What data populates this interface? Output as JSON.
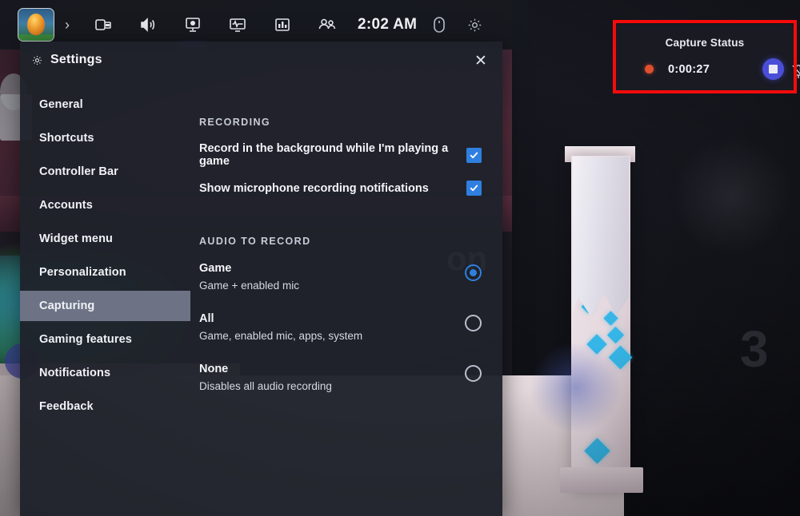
{
  "toolbar": {
    "game_thumbnail_name": "game-thumbnail",
    "expand_label": "›",
    "items": [
      {
        "id": "widget-store",
        "label": "Widget store",
        "icon": "widget-store-icon",
        "active": false
      },
      {
        "id": "audio",
        "label": "Audio",
        "icon": "speaker-icon",
        "active": false
      },
      {
        "id": "capture",
        "label": "Capture",
        "icon": "capture-monitor-icon",
        "active": true
      },
      {
        "id": "performance",
        "label": "Performance",
        "icon": "performance-monitor-icon",
        "active": false
      },
      {
        "id": "resources",
        "label": "Resources",
        "icon": "bar-chart-icon",
        "active": false
      },
      {
        "id": "xbox-social",
        "label": "Xbox Social",
        "icon": "people-icon",
        "active": false
      }
    ],
    "clock": "2:02 AM",
    "mouse_icon": "mouse-icon",
    "settings_icon": "gear-icon"
  },
  "settings": {
    "title": "Settings",
    "gear_icon": "gear-icon",
    "close_label": "✕",
    "nav": [
      {
        "label": "General",
        "selected": false
      },
      {
        "label": "Shortcuts",
        "selected": false
      },
      {
        "label": "Controller Bar",
        "selected": false
      },
      {
        "label": "Accounts",
        "selected": false
      },
      {
        "label": "Widget menu",
        "selected": false
      },
      {
        "label": "Personalization",
        "selected": false
      },
      {
        "label": "Capturing",
        "selected": true
      },
      {
        "label": "Gaming features",
        "selected": false
      },
      {
        "label": "Notifications",
        "selected": false
      },
      {
        "label": "Feedback",
        "selected": false
      }
    ],
    "recording": {
      "section_label": "RECORDING",
      "checkboxes": [
        {
          "label": "Record in the background while I'm playing a game",
          "checked": true
        },
        {
          "label": "Show microphone recording notifications",
          "checked": true
        }
      ]
    },
    "audio_to_record": {
      "section_label": "AUDIO TO RECORD",
      "options": [
        {
          "title": "Game",
          "subtitle": "Game + enabled mic",
          "selected": true
        },
        {
          "title": "All",
          "subtitle": "Game, enabled mic, apps, system",
          "selected": false
        },
        {
          "title": "None",
          "subtitle": "Disables all audio recording",
          "selected": false
        }
      ]
    }
  },
  "capture_status": {
    "title": "Capture Status",
    "recording_indicator": "recording-dot",
    "elapsed_time": "0:00:27",
    "stop_button_label": "stop-recording-button",
    "mic_icon": "microphone-muted-icon"
  },
  "annotation": {
    "name": "red-highlight-box",
    "color": "#f60b0b"
  },
  "colors": {
    "accent_blue": "#2f7fe0",
    "tab_indicator": "#3a5bd9",
    "record_red": "#e0502f",
    "stop_violet": "#4a4ed6",
    "panel_bg": "#1f222a",
    "nav_selected": "#6d7385"
  },
  "background": {
    "scene_name": "game-scene-roblox",
    "sign_number": "3"
  }
}
